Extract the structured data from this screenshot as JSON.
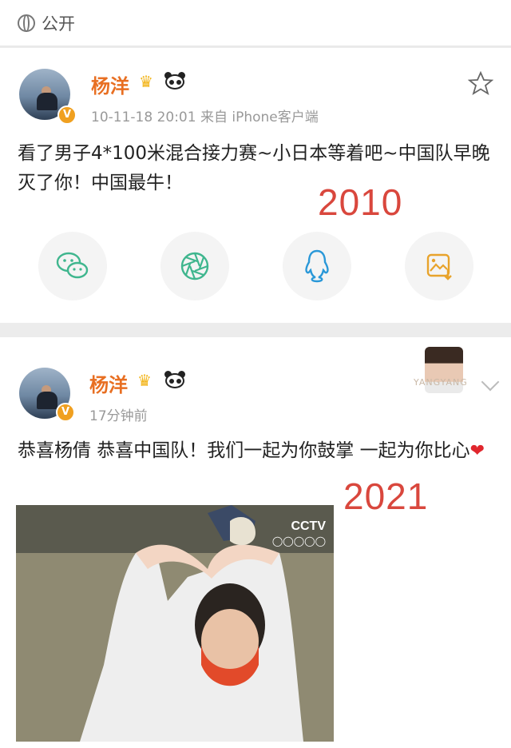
{
  "topbar": {
    "visibility_label": "公开",
    "icon": "globe-icon"
  },
  "posts": [
    {
      "username": "杨洋",
      "meta": "10-11-18 20:01  来自 iPhone客户端",
      "text": "看了男子4*100米混合接力赛~小日本等着吧~中国队早晚灭了你！中国最牛！",
      "year_overlay": "2010",
      "share_icons": [
        "wechat-icon",
        "moments-icon",
        "qq-icon",
        "save-image-icon"
      ],
      "share_colors": {
        "wechat": "#3fb68e",
        "moments": "#3fb68e",
        "qq": "#2a98d8",
        "save": "#e8a32b"
      }
    },
    {
      "username": "杨洋",
      "meta": "17分钟前",
      "text": "恭喜杨倩 恭喜中国队！我们一起为你鼓掌 一起为你比心",
      "heart": "❤",
      "year_overlay": "2021",
      "promo_text": "YANGYANG",
      "video": {
        "channel_logo": "CCTV",
        "rings": "◯◯◯◯◯"
      }
    }
  ],
  "colors": {
    "username": "#e86f22",
    "year": "#d9473d",
    "badge": "#f0a020"
  }
}
